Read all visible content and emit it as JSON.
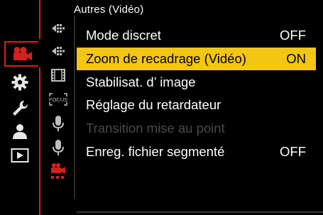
{
  "header": {
    "title": "Autres (Vidéo)"
  },
  "categories": [
    {
      "name": "video-camera-icon",
      "active": true,
      "color": "#d3211f"
    },
    {
      "name": "gear-icon",
      "active": false
    },
    {
      "name": "wrench-icon",
      "active": false
    },
    {
      "name": "person-icon",
      "active": false
    },
    {
      "name": "playback-icon",
      "active": false
    }
  ],
  "subtabs": [
    {
      "name": "photo-subtab-icon"
    },
    {
      "name": "video-subtab-icon"
    },
    {
      "name": "film-icon"
    },
    {
      "name": "focus-icon",
      "text": "FOCUS"
    },
    {
      "name": "microphone-icon"
    },
    {
      "name": "microphone-icon-2"
    },
    {
      "name": "video-other-icon",
      "active": true
    }
  ],
  "menu": {
    "items": [
      {
        "label": "Mode discret",
        "value": "OFF",
        "state": "normal"
      },
      {
        "label": "Zoom de recadrage (Vidéo)",
        "value": "ON",
        "state": "selected"
      },
      {
        "label": "Stabilisat. d’ image",
        "value": "",
        "state": "normal"
      },
      {
        "label": "Réglage du retardateur",
        "value": "",
        "state": "normal"
      },
      {
        "label": "Transition mise au point",
        "value": "",
        "state": "disabled"
      },
      {
        "label": "Enreg. fichier segmenté",
        "value": "OFF",
        "state": "normal"
      }
    ]
  },
  "colors": {
    "accent_red": "#d3211f",
    "highlight_yellow": "#f3c613",
    "disabled_gray": "#4a4a4a"
  }
}
